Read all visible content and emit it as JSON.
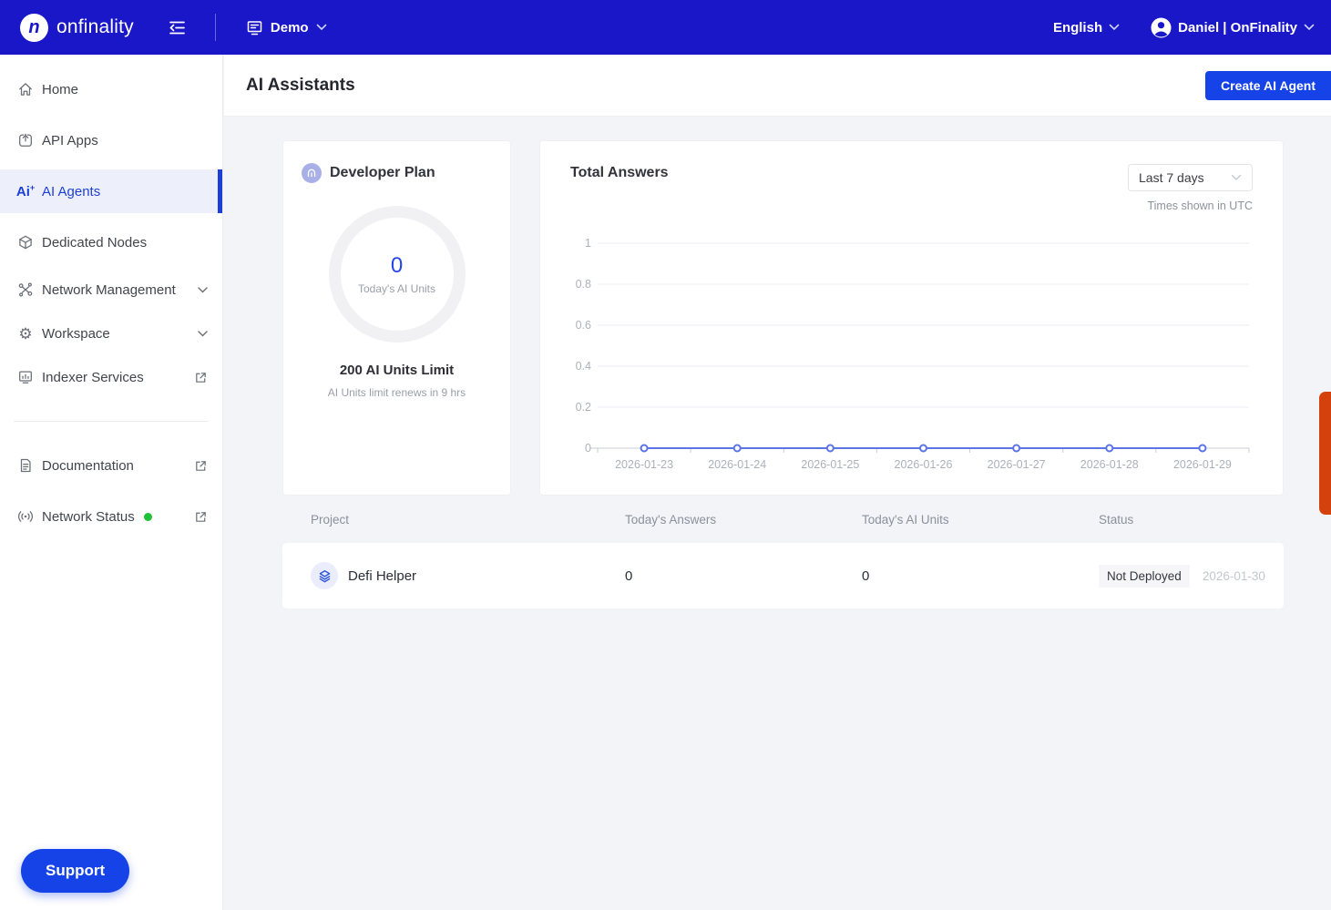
{
  "navbar": {
    "brand": "onfinality",
    "logo_letter": "n",
    "workspace": "Demo",
    "language": "English",
    "user": "Daniel | OnFinality"
  },
  "sidebar": {
    "items": [
      {
        "label": "Home",
        "icon": "home-icon"
      },
      {
        "label": "API Apps",
        "icon": "api-apps-icon"
      },
      {
        "label": "AI Agents",
        "icon": "ai-agents-icon",
        "active": true
      },
      {
        "label": "Dedicated Nodes",
        "icon": "cube-icon"
      },
      {
        "label": "Network Management",
        "icon": "network-icon",
        "chevron": true
      },
      {
        "label": "Workspace",
        "icon": "gear-icon",
        "chevron": true
      },
      {
        "label": "Indexer Services",
        "icon": "monitor-chart-icon",
        "external": true
      }
    ],
    "footer_items": [
      {
        "label": "Documentation",
        "icon": "document-icon",
        "external": true
      },
      {
        "label": "Network Status",
        "icon": "broadcast-icon",
        "external": true,
        "status_dot": true
      }
    ],
    "support_label": "Support",
    "ai_glyph": "Ai",
    "ai_glyph_plus": "+",
    "gear_glyph": "⚙"
  },
  "header": {
    "title": "AI Assistants",
    "create_button": "Create AI Agent"
  },
  "plan_card": {
    "title": "Developer Plan",
    "units_value": "0",
    "units_label": "Today's AI Units",
    "limit_text": "200 AI Units Limit",
    "renews_text": "AI Units limit renews in 9 hrs"
  },
  "chart_card": {
    "title": "Total Answers",
    "range_selected": "Last 7 days",
    "timezone_note": "Times shown in UTC"
  },
  "chart_data": {
    "type": "line",
    "title": "Total Answers",
    "x": [
      "2026-01-23",
      "2026-01-24",
      "2026-01-25",
      "2026-01-26",
      "2026-01-27",
      "2026-01-28",
      "2026-01-29"
    ],
    "series": [
      {
        "name": "Total Answers",
        "values": [
          0,
          0,
          0,
          0,
          0,
          0,
          0
        ]
      }
    ],
    "xlabel": "",
    "ylabel": "",
    "ylim": [
      0,
      1
    ],
    "yticks": [
      0,
      0.2,
      0.4,
      0.6,
      0.8,
      1
    ],
    "grid": true,
    "legend_position": "none",
    "marker": "open-circle"
  },
  "table": {
    "columns": [
      "Project",
      "Today's Answers",
      "Today's AI Units",
      "Status"
    ],
    "rows": [
      {
        "project": "Defi Helper",
        "answers": "0",
        "units": "0",
        "status": "Not Deployed",
        "date": "2026-01-30"
      }
    ]
  },
  "colors": {
    "navbar_bg": "#1a17c9",
    "button_blue": "#1543e8",
    "active_blue": "#1d3fd6",
    "chart_line": "#5b74e6",
    "grid_line": "#e8ecf4",
    "axis_line": "#c9cdd5",
    "axis_text": "#abb1bc",
    "ring_track": "#f1f1f4",
    "page_bg": "#f3f4f8",
    "status_green": "#21c134",
    "feedback_orange": "#d5410d",
    "plan_icon_bg": "#a9b0e8"
  }
}
